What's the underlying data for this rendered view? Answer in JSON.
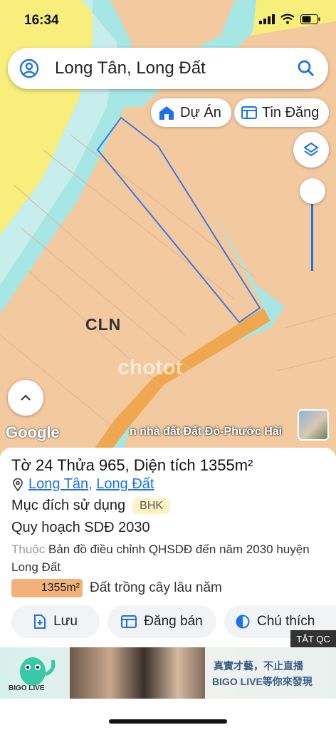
{
  "status_bar": {
    "time": "16:34"
  },
  "search": {
    "query": "Long Tân, Long Đất"
  },
  "chips": {
    "projects": "Dự Án",
    "listings": "Tin Đăng"
  },
  "map": {
    "land_code": "CLN",
    "google_logo": "Google",
    "street_banner": "n nhà đất Đất Đỏ-Phước Hải",
    "watermark": "chotot"
  },
  "parcel": {
    "title": "Tờ 24 Thửa 965, Diện tích 1355m²",
    "commune": "Long Tân",
    "separator": ", ",
    "district": "Long Đất",
    "purpose_label": "Mục đích sử dụng",
    "purpose_code": "BHK",
    "plan_label": "Quy hoạch SDĐ 2030",
    "belongs_prefix": "Thuộc",
    "belongs_text": "Bản đồ điều chỉnh QHSDĐ đến năm 2030 huyện Long Đất",
    "area_value": "1355m²",
    "area_desc": "Đất trồng cây lâu năm"
  },
  "actions": {
    "save": "Lưu",
    "post": "Đăng bán",
    "legend": "Chú thích"
  },
  "ad": {
    "close": "TẮT QC",
    "brand": "BIGO LIVE",
    "cn_line1": "真實才藝，不止直播",
    "cn_line2": "BIGO LIVE等你來發現"
  },
  "colors": {
    "accent": "#1a73e8",
    "land": "#f3c9a0",
    "river": "#a6e6e4",
    "road": "#f0a850"
  }
}
